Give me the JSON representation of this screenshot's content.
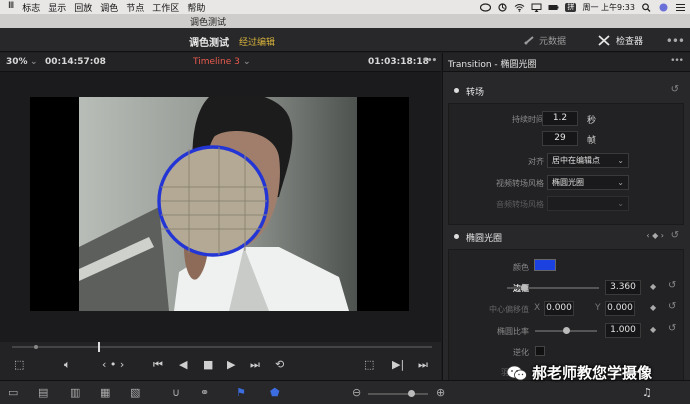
{
  "menubar": {
    "items": [
      "Ⅲ",
      "标志",
      "显示",
      "回放",
      "调色",
      "节点",
      "工作区",
      "帮助"
    ],
    "clock": "周一 上午9:33",
    "ime_label": "拼"
  },
  "window": {
    "title": "调色测试"
  },
  "header": {
    "project_name": "调色测试",
    "edited_label": "经过编辑",
    "metadata_label": "元数据",
    "inspector_label": "检查器",
    "more": "•••"
  },
  "viewer": {
    "zoom": "30%",
    "zoom_arrow": "⌄",
    "source_timecode": "00:14:57:08",
    "timeline_name": "Timeline 3",
    "timeline_arrow": "⌄",
    "record_timecode": "01:03:18:18",
    "more": "•••"
  },
  "inspector": {
    "title": "Transition - 椭圆光圈",
    "more": "•••",
    "transition_section": {
      "title": "转场",
      "duration_label": "持续时间",
      "duration_seconds": "1.2",
      "seconds_unit": "秒",
      "duration_frames": "29",
      "frames_unit": "帧",
      "alignment_label": "对齐",
      "alignment_value": "居中在编辑点",
      "video_style_label": "视频转场风格",
      "video_style_value": "椭圆光圈",
      "audio_style_label": "音频转场风格",
      "audio_style_value": ""
    },
    "iris_section": {
      "title": "椭圆光圈",
      "nav": "‹ ◆ ›",
      "color_label": "颜色",
      "color": "#1b41e0",
      "border_label": "边框",
      "border_value": "3.360",
      "border_fraction": 0.18,
      "center_label": "中心偏移值",
      "x_label": "X",
      "x_value": "0.000",
      "y_label": "Y",
      "y_value": "0.000",
      "ratio_label": "椭圆比率",
      "ratio_value": "1.000",
      "ratio_fraction": 0.5,
      "reverse_label": "逆化",
      "extra_label": "羽"
    }
  },
  "watermark": {
    "text": "郝老师教您学摄像"
  }
}
